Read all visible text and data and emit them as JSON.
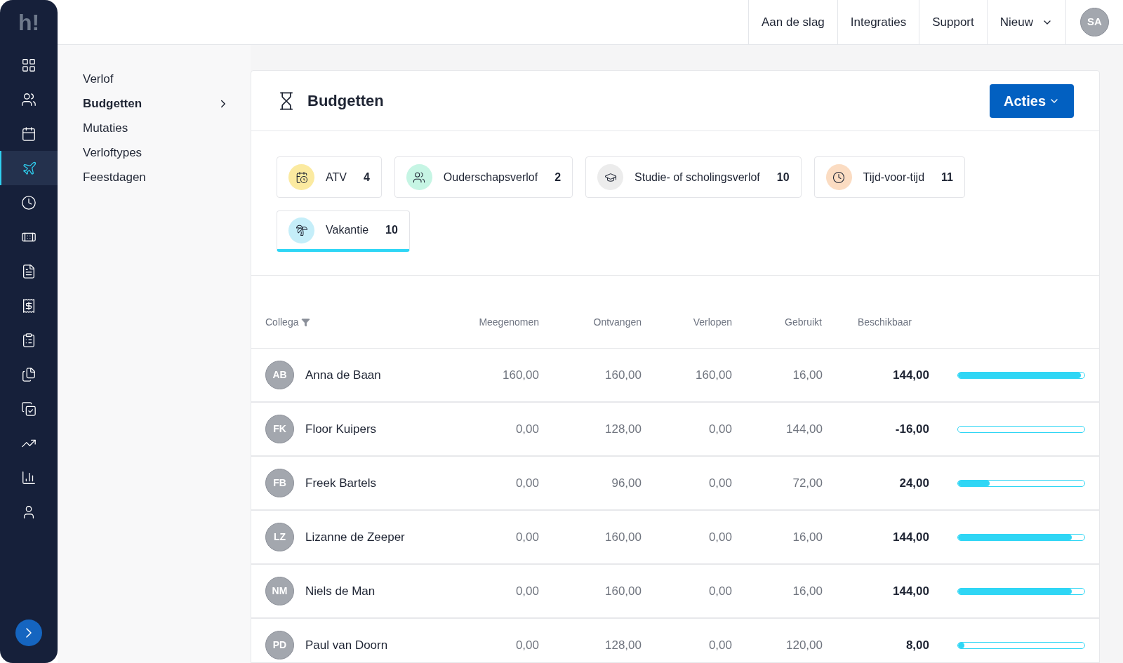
{
  "logo": "h!",
  "rail": [
    {
      "selected": false
    },
    {
      "selected": false
    },
    {
      "selected": false
    },
    {
      "selected": true
    },
    {
      "selected": false
    },
    {
      "selected": false
    },
    {
      "selected": false
    },
    {
      "selected": false
    },
    {
      "selected": false
    },
    {
      "selected": false
    },
    {
      "selected": false
    },
    {
      "selected": false
    },
    {
      "selected": false
    },
    {
      "selected": false
    }
  ],
  "topnav": [
    {
      "label": "Aan de slag",
      "dropdown": false
    },
    {
      "label": "Integraties",
      "dropdown": false
    },
    {
      "label": "Support",
      "dropdown": false
    },
    {
      "label": "Nieuw",
      "dropdown": true
    }
  ],
  "avatar": "SA",
  "subnav": [
    {
      "label": "Verlof",
      "selected": false
    },
    {
      "label": "Budgetten",
      "selected": true
    },
    {
      "label": "Mutaties",
      "selected": false
    },
    {
      "label": "Verloftypes",
      "selected": false
    },
    {
      "label": "Feestdagen",
      "selected": false
    }
  ],
  "title": "Budgetten",
  "actions": "Acties",
  "types": [
    {
      "label": "ATV",
      "count": "4",
      "color": "#fbeaa0",
      "selected": false
    },
    {
      "label": "Ouderschapsverlof",
      "count": "2",
      "color": "#c6f5e4",
      "selected": false
    },
    {
      "label": "Studie- of scholingsverlof",
      "count": "10",
      "color": "#ececec",
      "selected": false
    },
    {
      "label": "Tijd-voor-tijd",
      "count": "11",
      "color": "#fbdcc2",
      "selected": false
    },
    {
      "label": "Vakantie",
      "count": "10",
      "color": "#c5eef9",
      "selected": true
    }
  ],
  "columns": [
    "Collega",
    "Meegenomen",
    "Ontvangen",
    "Verlopen",
    "Gebruikt",
    "Beschikbaar"
  ],
  "rows": [
    {
      "initials": "AB",
      "name": "Anna de Baan",
      "values": [
        "160,00",
        "160,00",
        "160,00",
        "16,00"
      ],
      "available": "144,00",
      "level": 0.97
    },
    {
      "initials": "FK",
      "name": "Floor Kuipers",
      "values": [
        "0,00",
        "128,00",
        "0,00",
        "144,00"
      ],
      "available": "-16,00",
      "level": 0
    },
    {
      "initials": "FB",
      "name": "Freek Bartels",
      "values": [
        "0,00",
        "96,00",
        "0,00",
        "72,00"
      ],
      "available": "24,00",
      "level": 0.25
    },
    {
      "initials": "LZ",
      "name": "Lizanne de Zeeper",
      "values": [
        "0,00",
        "160,00",
        "0,00",
        "16,00"
      ],
      "available": "144,00",
      "level": 0.9
    },
    {
      "initials": "NM",
      "name": "Niels de Man",
      "values": [
        "0,00",
        "160,00",
        "0,00",
        "16,00"
      ],
      "available": "144,00",
      "level": 0.9
    },
    {
      "initials": "PD",
      "name": "Paul van Doorn",
      "values": [
        "0,00",
        "128,00",
        "0,00",
        "120,00"
      ],
      "available": "8,00",
      "level": 0.05
    }
  ]
}
